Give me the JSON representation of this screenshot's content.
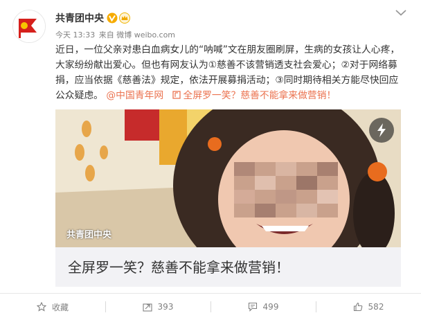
{
  "post": {
    "username": "共青团中央",
    "verified_icon": "verified-v-icon",
    "member_icon": "crown-icon",
    "time": "今天 13:33",
    "source": "来自 微博 weibo.com",
    "text_main": "近日，一位父亲对患白血病女儿的“呐喊”文在朋友圈刷屏，生病的女孩让人心疼，大家纷纷献出爱心。但也有网友认为①慈善不该营销透支社会爱心；②对于网络募捐，应当依据《慈善法》规定，依法开展募捐活动；③同时期待相关方能尽快回应公众疑虑。",
    "mention": "@中国青年网",
    "link_text": "全屏罗一笑？慈善不能拿来做营销！"
  },
  "card": {
    "image_caption": "共青团中央",
    "title": "全屏罗一笑？慈善不能拿来做营销！"
  },
  "actions": {
    "favorite_label": "收藏",
    "repost_count": "393",
    "comment_count": "499",
    "like_count": "582"
  },
  "colors": {
    "link": "#eb7350",
    "text": "#333333",
    "meta": "#808080",
    "card_bg": "#f2f2f5",
    "verified": "#f6ab00"
  }
}
